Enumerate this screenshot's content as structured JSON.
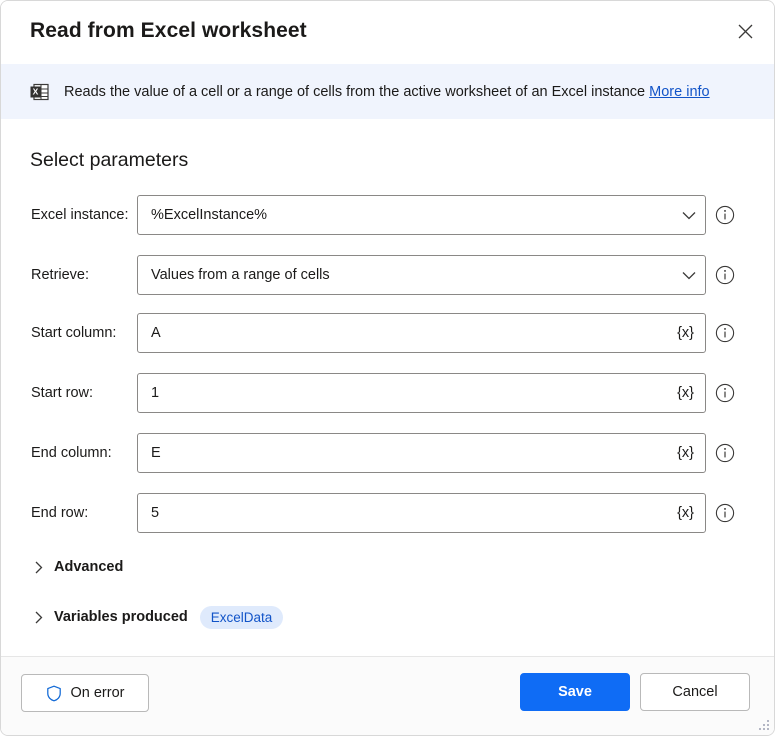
{
  "window": {
    "title": "Read from Excel worksheet",
    "close_icon": "close-icon",
    "resize_grip": "resize-grip"
  },
  "banner": {
    "icon": "excel-worksheet-icon",
    "text": "Reads the value of a cell or a range of cells from the active worksheet of an Excel instance",
    "link_label": "More info",
    "link_color": "#1254c8",
    "background": "#f0f4fd"
  },
  "main": {
    "section_title": "Select parameters",
    "fields": [
      {
        "label": "Excel instance:",
        "value": "%ExcelInstance%",
        "control": "dropdown",
        "name": "excel-instance"
      },
      {
        "label": "Retrieve:",
        "value": "Values from a range of cells",
        "control": "dropdown",
        "name": "retrieve"
      },
      {
        "label": "Start column:",
        "value": "A",
        "control": "textbox",
        "variable_button": "{x}",
        "name": "start-column"
      },
      {
        "label": "Start row:",
        "value": "1",
        "control": "textbox",
        "variable_button": "{x}",
        "name": "start-row"
      },
      {
        "label": "End column:",
        "value": "E",
        "control": "textbox",
        "variable_button": "{x}",
        "name": "end-column"
      },
      {
        "label": "End row:",
        "value": "5",
        "control": "textbox",
        "variable_button": "{x}",
        "name": "end-row"
      }
    ],
    "expanders": [
      {
        "label": "Advanced",
        "name": "advanced",
        "expanded": false
      },
      {
        "label": "Variables produced",
        "name": "variables-produced",
        "expanded": false
      }
    ],
    "produced_variable": "ExcelData"
  },
  "footer": {
    "on_error_label": "On error",
    "save_label": "Save",
    "cancel_label": "Cancel",
    "save_color": "#0f6cf5"
  }
}
